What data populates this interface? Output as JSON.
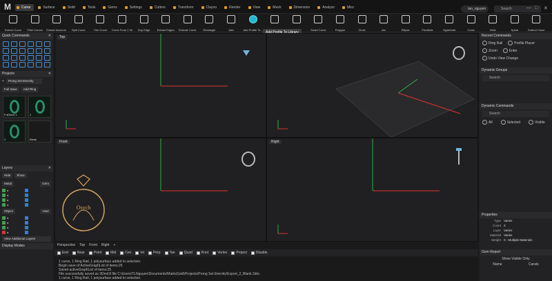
{
  "app": {
    "logo": "M"
  },
  "menu": {
    "tabs": [
      "Curve",
      "Surface",
      "Solid",
      "Tools",
      "Gems",
      "Settings",
      "Cutters",
      "Transform",
      "Clayoo",
      "Render",
      "View",
      "Mesh",
      "Dimension",
      "Analyze",
      "Misc"
    ],
    "active_tab": "Curve",
    "user": "tan_nguyen",
    "search_placeholder": "Search"
  },
  "toolbar": {
    "tools": [
      "Extend Curve",
      "Fillet Curves",
      "Extract Isocurve Fr...",
      "Split Curve",
      "Trim Curve",
      "Curve From 2 Views",
      "Dup Edge",
      "Extract Edges",
      "Extrude Curve",
      "Rectangle",
      "Add",
      "Add Profile To...",
      "",
      "Polyline",
      "Smart Curve",
      "Polygon",
      "Circle",
      "Arc",
      "Ellipse",
      "Parabola",
      "Hyperbola",
      "Conic",
      "Helix",
      "Spiral",
      "Extend Curve"
    ],
    "tooltip": "Add Profile To Library"
  },
  "left": {
    "quick_commands": "Quick Commands",
    "projects": "Projects",
    "project_select": "Prong Set Eternity",
    "full_save": "Full Save",
    "add_ring": "Add Ring",
    "thumbs": [
      "FullSave 1",
      "1",
      "2",
      "Blank"
    ],
    "layers": "Layers",
    "hide": "Hide",
    "show": "Show",
    "group_metal": "Metal",
    "group_gem": "Gem",
    "group_object": "Object",
    "group_user": "User",
    "view_layers": "View Additional Layers",
    "display_modes": "Display Modes"
  },
  "viewports": {
    "top": "Top",
    "front": "Front",
    "right": "Right",
    "tabs": [
      "Perspective",
      "Top",
      "Front",
      "Right"
    ]
  },
  "snaps": [
    "End",
    "Near",
    "Point",
    "Mid",
    "Cen",
    "Int",
    "Perp",
    "Tan",
    "Quad",
    "Knot",
    "Vertex",
    "Project",
    "Disable"
  ],
  "console": [
    "1 curve, 1 Ring Rail, 1 polysurface added to selection.",
    "Begin save of ActiveGraphList of items:25",
    "Saved activeGraphList of items:25",
    "File successfully saved as 3Dmil.8 file C:\\Users\\TLNguyen\\Documents\\MatrixGold\\Projects\\Prong Set Eternity\\Export_2_Blank.3dm.",
    "1 curve, 1 Ring Rail, 1 polysurface added to selection."
  ],
  "right": {
    "recent": "Recent Commands",
    "recent_items": [
      "Ring Rail",
      "Profile Placer",
      "Zoom",
      "Enter",
      "Undo View Change"
    ],
    "dynamic_groups": "Dynamic Groups",
    "dg_search": "Search",
    "dynamic_commands": "Dynamic Commands",
    "dc_search": "Search",
    "filter": [
      "All",
      "Selected",
      "Visible"
    ],
    "properties": "Properties",
    "props": [
      {
        "k": "Type",
        "v": "Varies"
      },
      {
        "k": "Count",
        "v": "3"
      },
      {
        "k": "Layer",
        "v": "Varies"
      },
      {
        "k": "Material",
        "v": "Varies"
      },
      {
        "k": "Weight",
        "v": "0 - Multiple Materials"
      }
    ],
    "gem_report": "Gem Report",
    "show_visible_only": "Show Visible Only",
    "name_col": "Name",
    "carats_col": "Carats"
  },
  "watermark": {
    "text": "Osych"
  },
  "colors": {
    "accent": "#e09a30",
    "x_axis": "#e23030",
    "y_axis": "#2fae42",
    "highlight": "#2bb4d0"
  }
}
